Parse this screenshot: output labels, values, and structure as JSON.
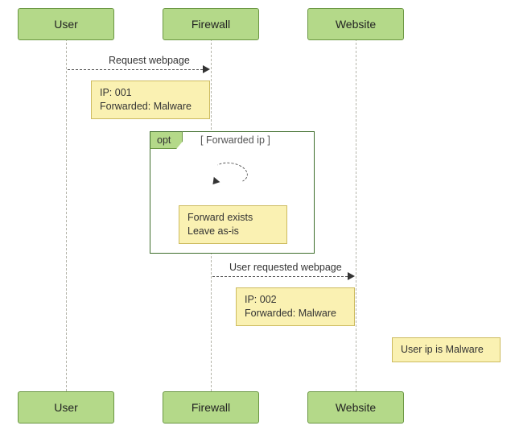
{
  "chart_data": {
    "type": "sequence",
    "participants": [
      "User",
      "Firewall",
      "Website"
    ],
    "messages": [
      {
        "from": "User",
        "to": "Firewall",
        "label": "Request webpage",
        "style": "dashed"
      },
      {
        "from": "Firewall",
        "to": "Website",
        "label": "User requested webpage",
        "style": "dashed"
      }
    ],
    "notes": [
      {
        "over": "Firewall",
        "after": 0,
        "lines": [
          "IP: 001",
          "Forwarded: Malware"
        ]
      },
      {
        "over": "Firewall",
        "inside_opt": true,
        "lines": [
          "Forward exists",
          "Leave as-is"
        ]
      },
      {
        "over": "Website",
        "after": 1,
        "lines": [
          "IP: 002",
          "Forwarded: Malware"
        ]
      },
      {
        "right_of": "Website",
        "lines": [
          "User ip is Malware"
        ]
      }
    ],
    "fragments": [
      {
        "kind": "opt",
        "guard": "[ Forwarded ip ]",
        "self_message_on": "Firewall"
      }
    ]
  },
  "actors": {
    "user": "User",
    "firewall": "Firewall",
    "website": "Website"
  },
  "labels": {
    "request_webpage": "Request webpage",
    "user_requested_webpage": "User requested webpage",
    "opt": "opt",
    "guard": "[ Forwarded ip ]"
  },
  "notes": {
    "n1_l1": "IP: 001",
    "n1_l2": "Forwarded: Malware",
    "n2_l1": "Forward exists",
    "n2_l2": "Leave as-is",
    "n3_l1": "IP: 002",
    "n3_l2": "Forwarded: Malware",
    "n4_l1": "User ip is Malware"
  }
}
